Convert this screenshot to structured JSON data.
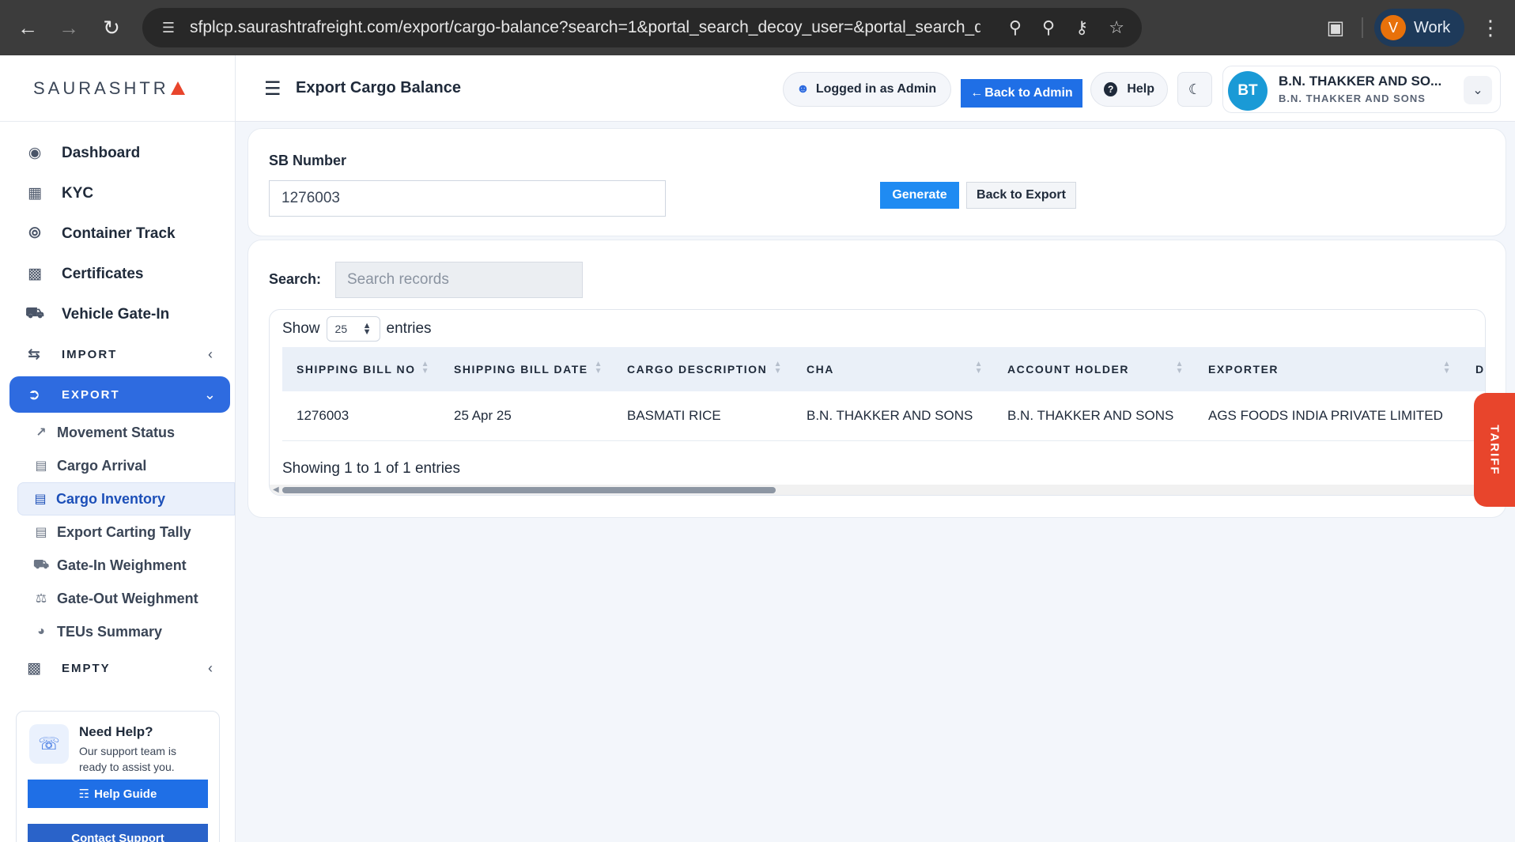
{
  "browser": {
    "url": "sfplcp.saurashtrafreight.com/export/cargo-balance?search=1&portal_search_decoy_user=&portal_search_decoy_password=&s...",
    "profile_initial": "V",
    "profile_label": "Work"
  },
  "sidebar": {
    "brand": "SAURASHTR",
    "items": [
      {
        "label": "Dashboard",
        "icon": "palette-icon"
      },
      {
        "label": "KYC",
        "icon": "id-card-icon"
      },
      {
        "label": "Container Track",
        "icon": "route-icon"
      },
      {
        "label": "Certificates",
        "icon": "file-certificate-icon"
      },
      {
        "label": "Vehicle Gate-In",
        "icon": "truck-icon"
      }
    ],
    "import_label": "IMPORT",
    "export_label": "EXPORT",
    "export_sub": [
      {
        "label": "Movement Status",
        "icon": "chart-line-icon"
      },
      {
        "label": "Cargo Arrival",
        "icon": "boxes-icon"
      },
      {
        "label": "Cargo Inventory",
        "icon": "warehouse-icon"
      },
      {
        "label": "Export Carting Tally",
        "icon": "clipboard-icon"
      },
      {
        "label": "Gate-In Weighment",
        "icon": "truck-icon"
      },
      {
        "label": "Gate-Out Weighment",
        "icon": "scale-icon"
      },
      {
        "label": "TEUs Summary",
        "icon": "pie-chart-icon"
      }
    ],
    "empty_label": "EMPTY",
    "help": {
      "title": "Need Help?",
      "text": "Our support team is ready to assist you.",
      "guide_btn": "Help Guide",
      "contact_btn": "Contact Support"
    }
  },
  "header": {
    "title": "Export Cargo Balance",
    "logged_in": "Logged in as Admin",
    "back_admin": "Back to Admin",
    "help": "Help",
    "user_initials": "BT",
    "user_name": "B.N. THAKKER AND SO...",
    "user_sub": "B.N. THAKKER AND SONS"
  },
  "form": {
    "sb_label": "SB Number",
    "sb_value": "1276003",
    "generate": "Generate",
    "back_export": "Back to Export"
  },
  "table": {
    "search_label": "Search:",
    "search_placeholder": "Search records",
    "show": "Show",
    "page_size": "25",
    "entries": "entries",
    "columns": [
      "SHIPPING BILL NO",
      "SHIPPING BILL DATE",
      "CARGO DESCRIPTION",
      "CHA",
      "ACCOUNT HOLDER",
      "EXPORTER",
      "DE"
    ],
    "rows": [
      [
        "1276003",
        "25 Apr 25",
        "BASMATI RICE",
        "B.N. THAKKER AND SONS",
        "B.N. THAKKER AND SONS",
        "AGS FOODS INDIA PRIVATE LIMITED",
        ""
      ]
    ],
    "info": "Showing 1 to 1 of 1 entries"
  },
  "tariff": "TARIFF"
}
